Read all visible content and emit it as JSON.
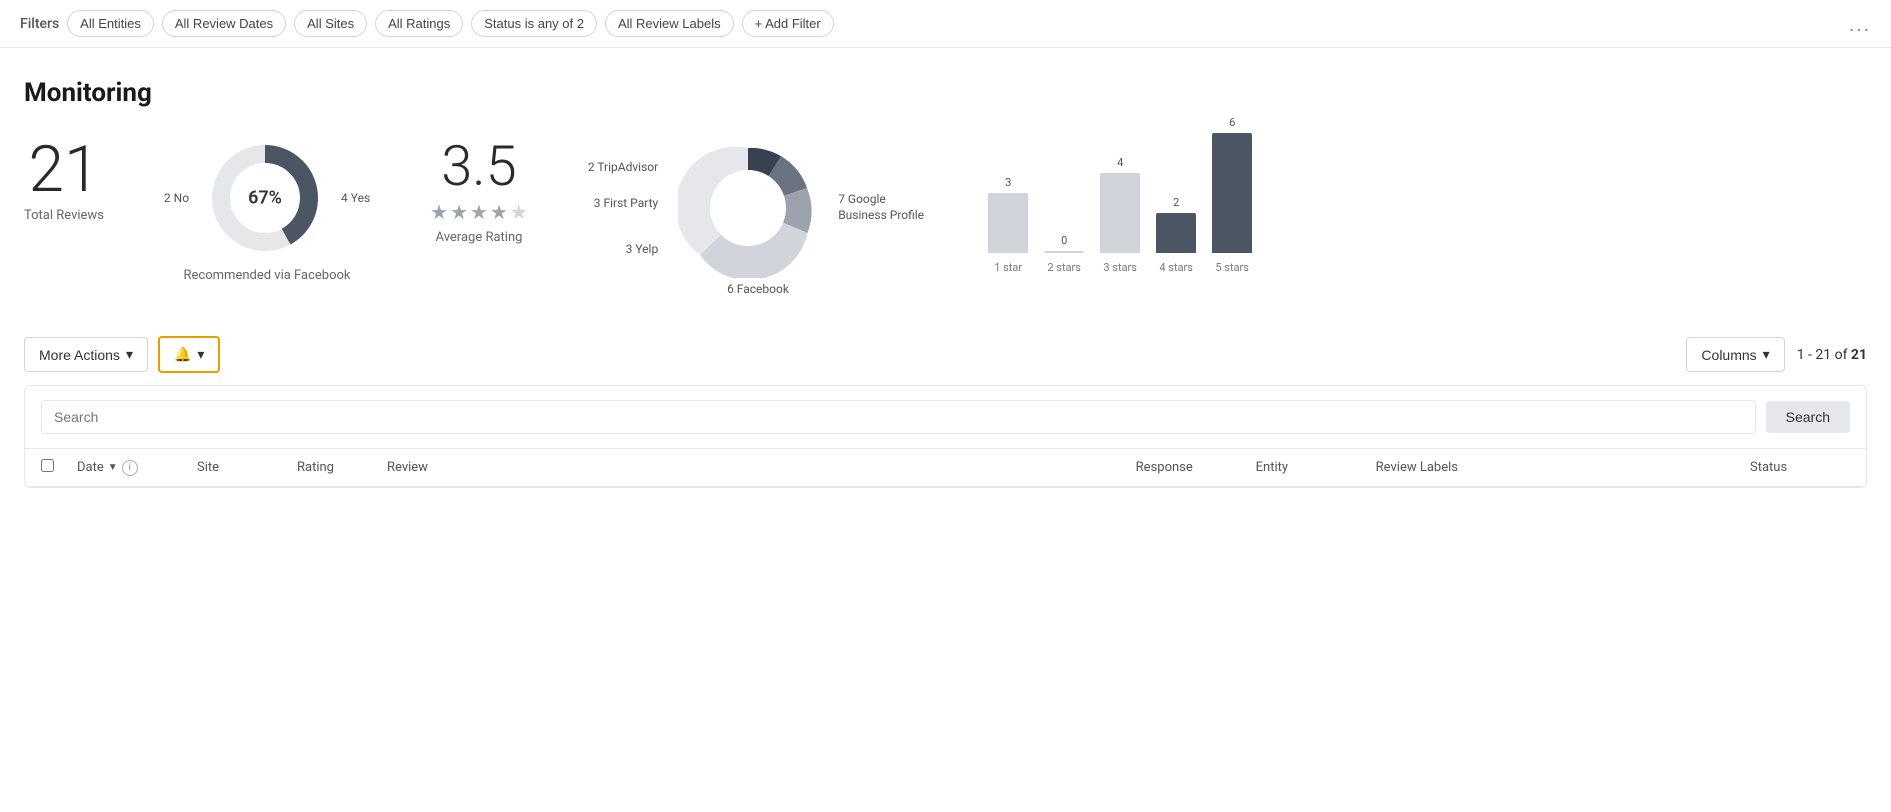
{
  "filterBar": {
    "label": "Filters",
    "chips": [
      {
        "id": "entities",
        "label": "All Entities"
      },
      {
        "id": "review-dates",
        "label": "All Review Dates"
      },
      {
        "id": "sites",
        "label": "All Sites"
      },
      {
        "id": "ratings",
        "label": "All Ratings"
      },
      {
        "id": "status",
        "label": "Status is any of 2"
      },
      {
        "id": "review-labels",
        "label": "All Review Labels"
      }
    ],
    "addFilter": "+ Add Filter",
    "moreOptions": "..."
  },
  "page": {
    "title": "Monitoring"
  },
  "stats": {
    "totalReviews": {
      "number": "21",
      "label": "Total Reviews"
    },
    "facebook": {
      "percentage": "67%",
      "noCount": "2 No",
      "yesCount": "4 Yes",
      "label": "Recommended via Facebook"
    },
    "averageRating": {
      "number": "3.5",
      "label": "Average Rating",
      "stars": [
        1,
        1,
        1,
        0.5,
        0
      ]
    },
    "sources": {
      "items": [
        {
          "label": "2 TripAdvisor",
          "side": "left"
        },
        {
          "label": "3 First Party",
          "side": "left"
        },
        {
          "label": "3 Yelp",
          "side": "left"
        },
        {
          "label": "7 Google Business Profile",
          "side": "right"
        },
        {
          "label": "6 Facebook",
          "side": "bottom"
        }
      ]
    },
    "barChart": {
      "bars": [
        {
          "label": "1 star",
          "value": 3,
          "type": "light"
        },
        {
          "label": "2 stars",
          "value": 0,
          "type": "light"
        },
        {
          "label": "3 stars",
          "value": 4,
          "type": "light"
        },
        {
          "label": "4 stars",
          "value": 2,
          "type": "dark"
        },
        {
          "label": "5 stars",
          "value": 6,
          "type": "dark"
        }
      ],
      "maxValue": 6
    }
  },
  "actions": {
    "moreActions": "More Actions",
    "columns": "Columns",
    "pagination": "1 - 21 of ",
    "paginationBold": "21"
  },
  "table": {
    "searchPlaceholder": "Search",
    "searchButton": "Search",
    "headers": {
      "date": "Date",
      "site": "Site",
      "rating": "Rating",
      "review": "Review",
      "response": "Response",
      "entity": "Entity",
      "reviewLabels": "Review Labels",
      "status": "Status"
    }
  }
}
